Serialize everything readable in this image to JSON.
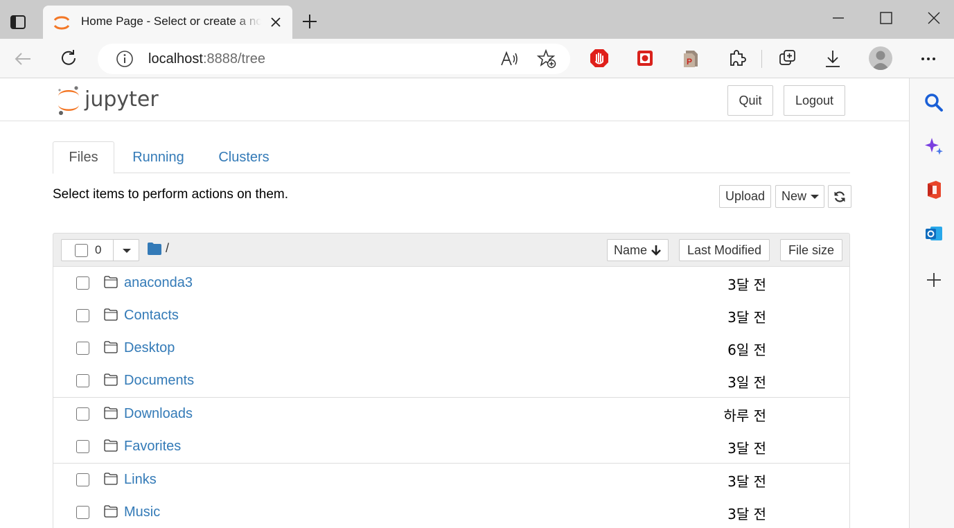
{
  "browser": {
    "tab_title": "Home Page - Select or create a notebook",
    "url_host": "localhost",
    "url_rest": ":8888/tree"
  },
  "header": {
    "logo_text": "jupyter",
    "quit_label": "Quit",
    "logout_label": "Logout"
  },
  "tabs": [
    {
      "label": "Files"
    },
    {
      "label": "Running"
    },
    {
      "label": "Clusters"
    }
  ],
  "toolbar": {
    "hint": "Select items to perform actions on them.",
    "upload_label": "Upload",
    "new_label": "New"
  },
  "list_header": {
    "selected_count": "0",
    "breadcrumb": "/",
    "name_label": "Name",
    "last_modified_label": "Last Modified",
    "file_size_label": "File size"
  },
  "items": [
    {
      "name": "anaconda3",
      "modified": "3달 전"
    },
    {
      "name": "Contacts",
      "modified": "3달 전"
    },
    {
      "name": "Desktop",
      "modified": "6일 전"
    },
    {
      "name": "Documents",
      "modified": "3일 전"
    },
    {
      "name": "Downloads",
      "modified": "하루 전"
    },
    {
      "name": "Favorites",
      "modified": "3달 전"
    },
    {
      "name": "Links",
      "modified": "3달 전"
    },
    {
      "name": "Music",
      "modified": "3달 전"
    }
  ],
  "colors": {
    "link": "#337ab7",
    "jupyter_orange": "#f37726"
  }
}
